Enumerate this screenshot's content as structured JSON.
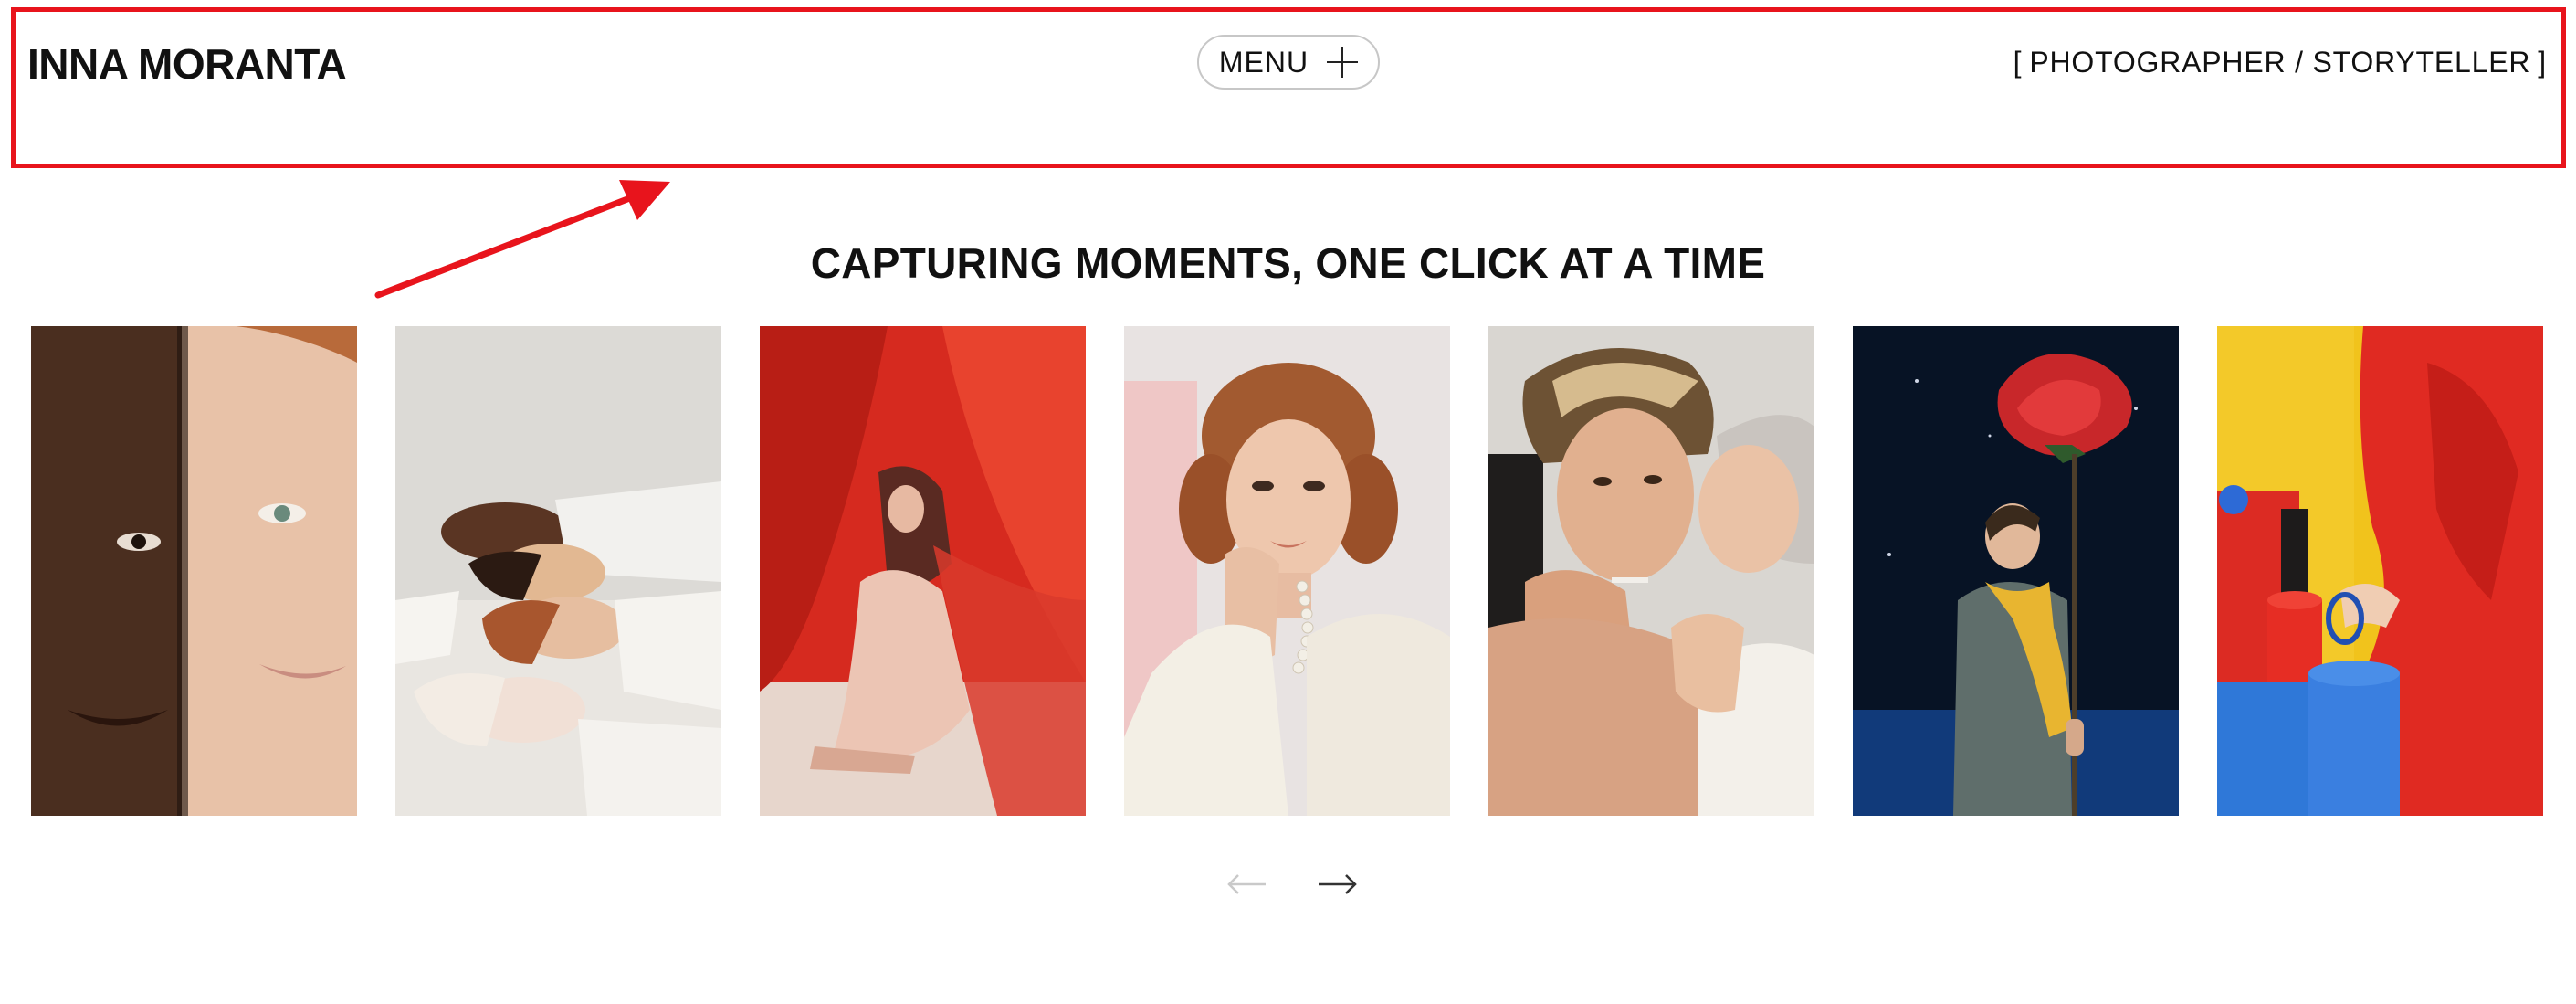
{
  "header": {
    "brand": "INNA MORANTA",
    "menu_label": "MENU",
    "tagline_open": "[",
    "tagline_text": "PHOTOGRAPHER / STORYTELLER",
    "tagline_close": "]"
  },
  "hero": {
    "title": "CAPTURING MOMENTS, ONE CLICK AT A TIME"
  },
  "gallery": {
    "photos": [
      {
        "subject": "two-faces-portrait"
      },
      {
        "subject": "four-faces-lying"
      },
      {
        "subject": "woman-red-curtain"
      },
      {
        "subject": "redhead-pearls-portrait"
      },
      {
        "subject": "couple-smoking"
      },
      {
        "subject": "man-giant-rose"
      },
      {
        "subject": "red-outfit-still-life"
      }
    ]
  },
  "pager": {
    "prev_icon": "arrow-left-icon",
    "next_icon": "arrow-right-icon",
    "prev_disabled": true
  },
  "colors": {
    "highlight": "#e8141c",
    "text": "#111111",
    "border": "#c7c7c7"
  }
}
